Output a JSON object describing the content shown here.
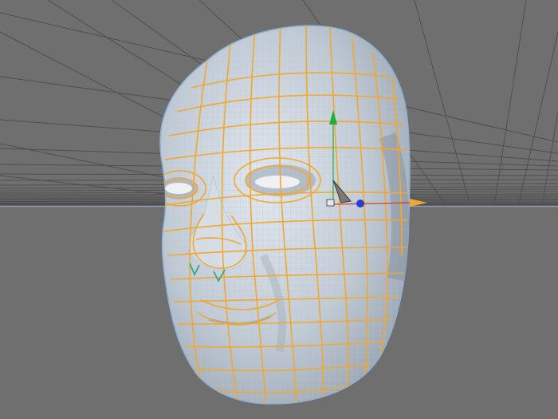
{
  "viewport": {
    "kind": "3D perspective viewport",
    "background_color": "#6f6f6f",
    "grid_line_color": "#4a4a4a",
    "horizon_color": "#8aa0b4",
    "grid_visible": true
  },
  "model": {
    "name": "head-mesh",
    "surface_color": "#c4ccd6",
    "wire_color": "#9fc4e4",
    "selected_edge_color": "#f0a830"
  },
  "gizmo": {
    "kind": "move-manipulator",
    "y_axis_color": "#1fae3a",
    "x_axis_color": "#d63a2a",
    "z_axis_color": "#2a3ed6",
    "handle_color": "#f0a830"
  },
  "icons": [
    "move-gizmo-icon",
    "object-axis-icon"
  ]
}
